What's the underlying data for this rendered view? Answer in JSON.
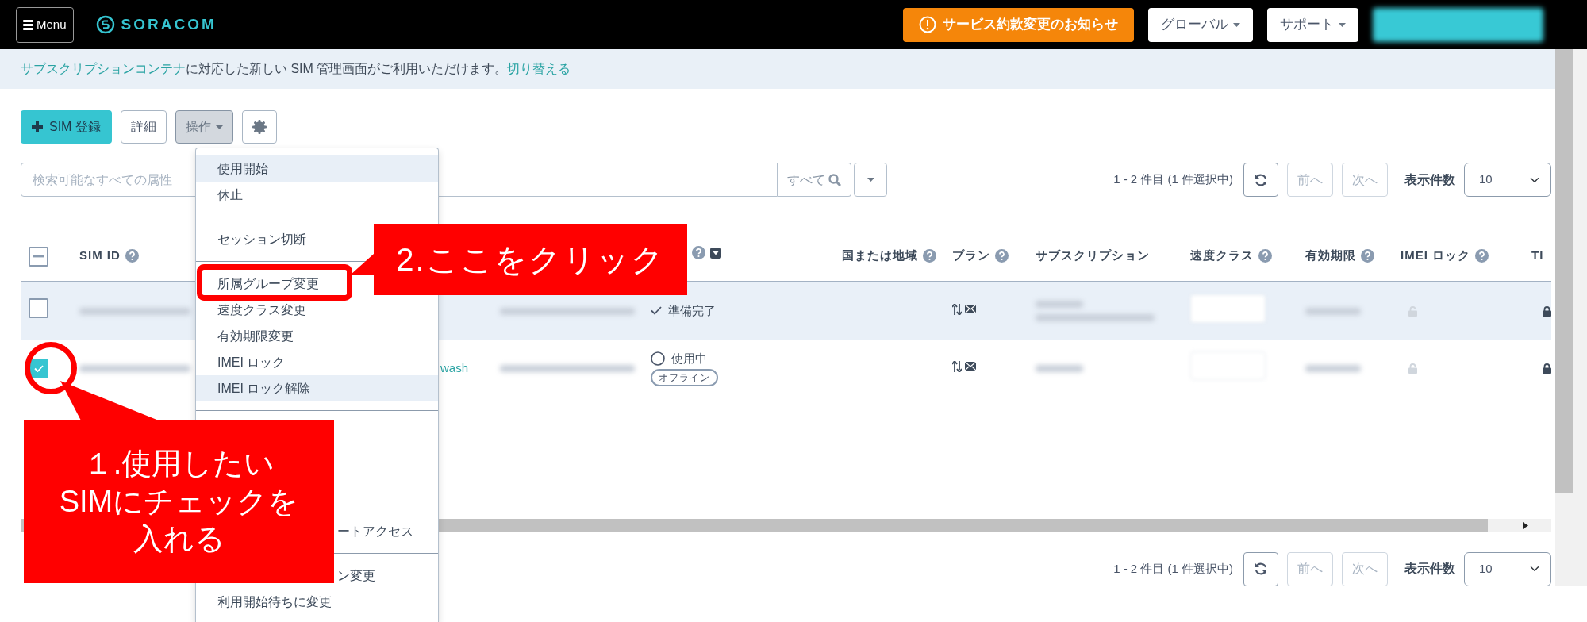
{
  "topbar": {
    "menu_button": "Menu",
    "brand": "SORACOM",
    "notice_button": "サービス約款変更のお知らせ",
    "buttons": [
      {
        "label": "グローバル"
      },
      {
        "label": "サポート"
      }
    ]
  },
  "banner": {
    "parts": [
      {
        "text": "サブスクリプションコンテナ",
        "link": true
      },
      {
        "text": "に対応した新しい SIM 管理画面がご利用いただけます。",
        "link": false
      },
      {
        "text": "切り替える",
        "link": true
      }
    ]
  },
  "toolbar": {
    "register_button": "SIM 登録",
    "detail_button": "詳細",
    "actions_button": {
      "label": "操作",
      "expanded": true
    }
  },
  "search": {
    "placeholder": "検索可能なすべての属性",
    "scope_button": "すべて"
  },
  "pagers": [
    {
      "range": "1 - 2 件目 (1 件選択中)",
      "prev": {
        "label": "前へ",
        "disabled": true
      },
      "next": {
        "label": "次へ",
        "disabled": true
      },
      "page_size_label": "表示件数",
      "page_size": "10"
    },
    {
      "range": "1 - 2 件目 (1 件選択中)",
      "prev": {
        "label": "前へ",
        "disabled": true
      },
      "next": {
        "label": "次へ",
        "disabled": true
      },
      "page_size_label": "表示件数",
      "page_size": "10"
    }
  ],
  "table": {
    "select_all": {
      "indeterminate": true
    },
    "columns": [
      {
        "label": "SIM ID",
        "help": true,
        "filter": false
      },
      {},
      {},
      {
        "help": true,
        "filter": true
      },
      {
        "label": "国または地域",
        "help": true,
        "filter": false
      },
      {
        "label": "プラン",
        "help": true,
        "filter": false
      },
      {
        "label": "サブスクリプション",
        "help": false,
        "filter": false
      },
      {
        "label": "速度クラス",
        "help": true,
        "filter": false
      },
      {
        "label": "有効期限",
        "help": true,
        "filter": false
      },
      {
        "label": "IMEI ロック",
        "help": true,
        "filter": false
      },
      {
        "label": "TI",
        "help": false,
        "filter": false
      }
    ],
    "rows": [
      {
        "selected": false,
        "highlighted": true,
        "status": {
          "kind": "ready",
          "label": "準備完了"
        },
        "imei_locked": false,
        "ti_locked": true
      },
      {
        "selected": true,
        "highlighted": false,
        "group": "wash",
        "status": {
          "kind": "in-use",
          "label": "使用中",
          "badge": "オフライン"
        },
        "imei_locked": false,
        "ti_locked": true
      }
    ]
  },
  "action_menu": {
    "items": [
      {
        "kind": "item",
        "label": "使用開始",
        "highlighted": true
      },
      {
        "kind": "item",
        "label": "休止",
        "highlighted": false
      },
      {
        "kind": "divider"
      },
      {
        "kind": "item",
        "label": "セッション切断",
        "highlighted": false
      },
      {
        "kind": "divider"
      },
      {
        "kind": "item",
        "label": "所属グループ変更",
        "highlighted": false
      },
      {
        "kind": "item",
        "label": "速度クラス変更",
        "highlighted": false
      },
      {
        "kind": "item",
        "label": "有効期限変更",
        "highlighted": false
      },
      {
        "kind": "item",
        "label": "IMEI ロック",
        "highlighted": false
      },
      {
        "kind": "item",
        "label": "IMEI ロック解除",
        "highlighted": true
      },
      {
        "kind": "divider"
      },
      {
        "kind": "covered"
      },
      {
        "kind": "covered"
      },
      {
        "kind": "covered"
      },
      {
        "kind": "covered"
      },
      {
        "kind": "partial",
        "label": "ートアクセス",
        "highlighted": false
      },
      {
        "kind": "divider"
      },
      {
        "kind": "partial",
        "label": "ン変更",
        "highlighted": false
      },
      {
        "kind": "item",
        "label": "利用開始待ちに変更",
        "highlighted": false
      }
    ]
  },
  "annotations": [
    {
      "kind": "menu-callout",
      "text": "2.ここをクリック"
    },
    {
      "kind": "checkbox-callout",
      "lines": [
        "１.使用したい",
        "SIMにチェックを",
        "入れる"
      ]
    }
  ]
}
